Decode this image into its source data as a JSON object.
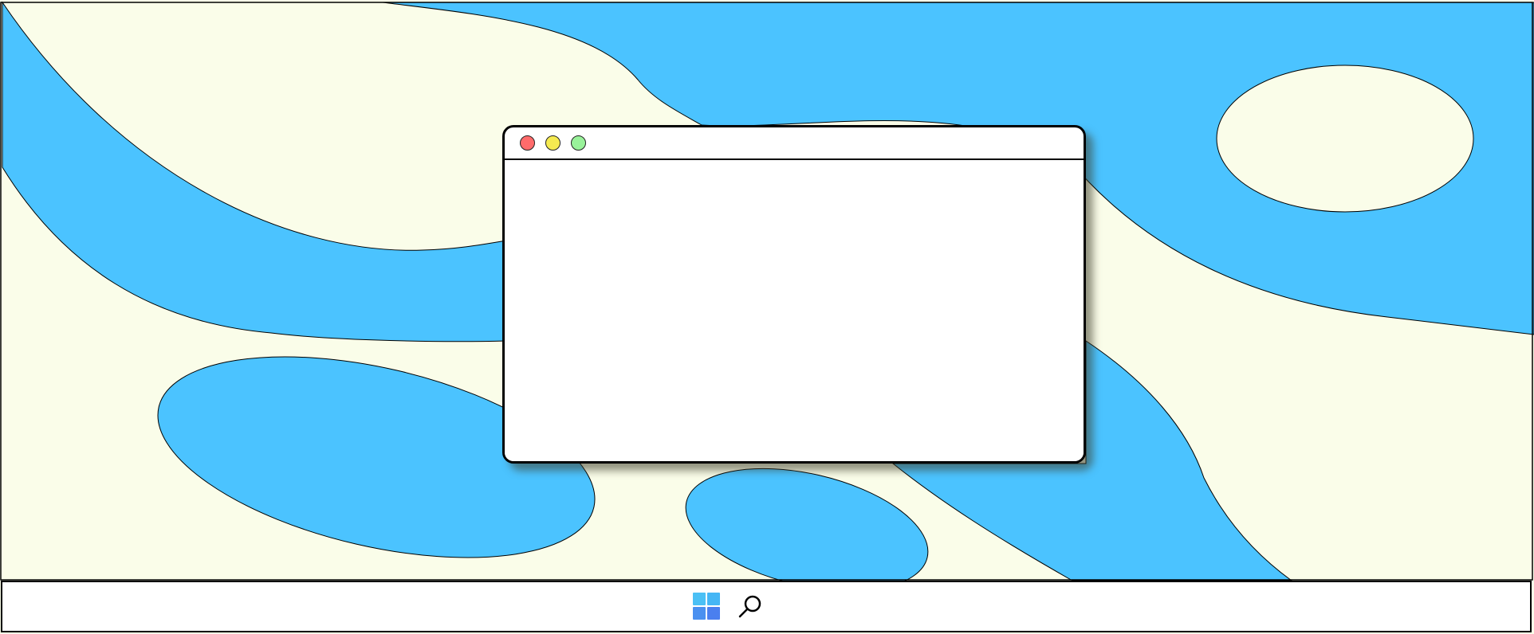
{
  "desktop": {
    "wallpaper": {
      "base_color": "#FAFDE9",
      "shape_color": "#4BC3FF",
      "outline_color": "#000000"
    }
  },
  "window": {
    "title": "",
    "controls": {
      "close": {
        "color": "#FF6B6B",
        "icon": "close-icon"
      },
      "minimize": {
        "color": "#F5EA50",
        "icon": "minimize-icon"
      },
      "maximize": {
        "color": "#99F29A",
        "icon": "maximize-icon"
      }
    },
    "border_color": "#000000",
    "background": "#FFFFFF"
  },
  "taskbar": {
    "background": "#FFFFFF",
    "items": [
      {
        "id": "start",
        "icon": "windows-logo-icon",
        "tile_colors": [
          "#4BC0F5",
          "#45B6F5",
          "#4A90F0",
          "#4A7FEF"
        ]
      },
      {
        "id": "search",
        "icon": "search-icon"
      }
    ]
  }
}
